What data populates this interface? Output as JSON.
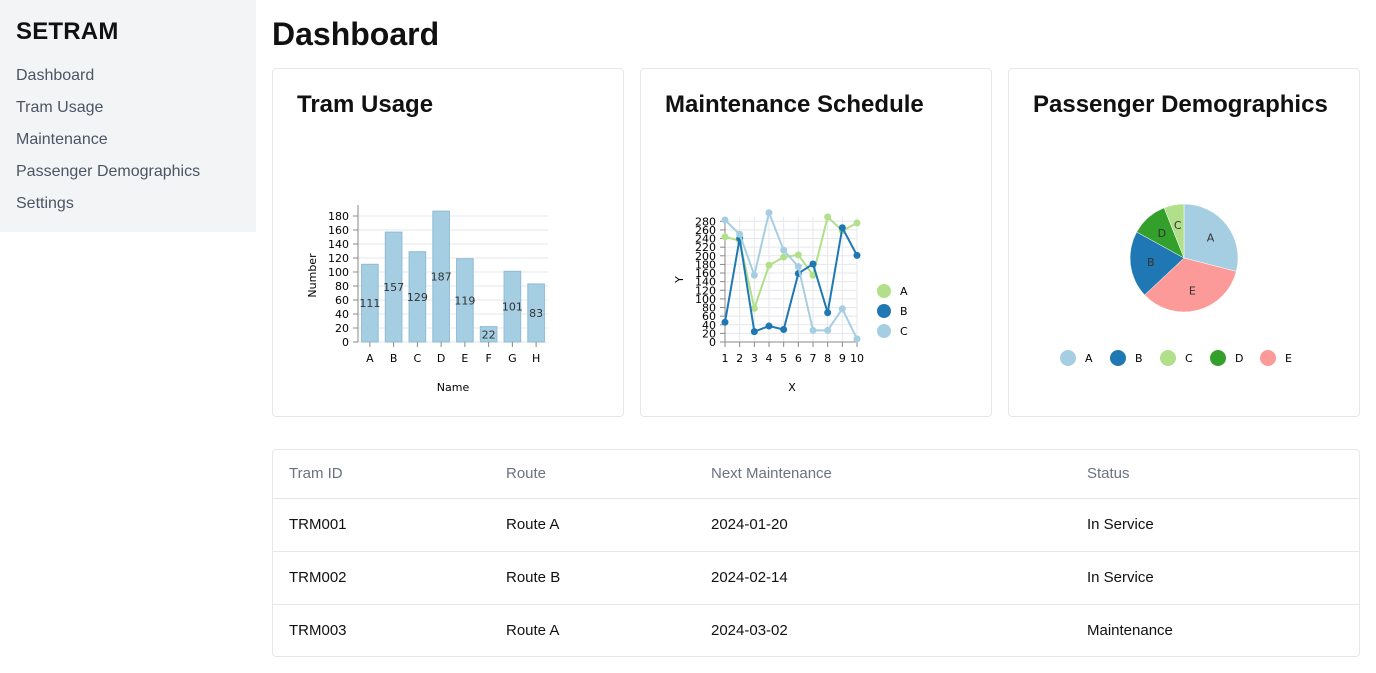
{
  "brand": "SETRAM",
  "nav": [
    {
      "label": "Dashboard",
      "name": "nav-item-dashboard"
    },
    {
      "label": "Tram Usage",
      "name": "nav-item-tram-usage"
    },
    {
      "label": "Maintenance",
      "name": "nav-item-maintenance"
    },
    {
      "label": "Passenger Demographics",
      "name": "nav-item-passenger-demographics"
    },
    {
      "label": "Settings",
      "name": "nav-item-settings"
    }
  ],
  "page_title": "Dashboard",
  "cards": {
    "usage_title": "Tram Usage",
    "maintenance_title": "Maintenance Schedule",
    "demographics_title": "Passenger Demographics"
  },
  "chart_data": [
    {
      "type": "bar",
      "title": "Tram Usage",
      "xlabel": "Name",
      "ylabel": "Number",
      "categories": [
        "A",
        "B",
        "C",
        "D",
        "E",
        "F",
        "G",
        "H"
      ],
      "values": [
        111,
        157,
        129,
        187,
        119,
        22,
        101,
        83
      ],
      "yticks": [
        0,
        20,
        40,
        60,
        80,
        100,
        120,
        140,
        160,
        180
      ],
      "ylim": [
        0,
        190
      ],
      "grid": true,
      "color": "#a6cee3"
    },
    {
      "type": "line",
      "title": "Maintenance Schedule",
      "xlabel": "X",
      "ylabel": "Y",
      "x": [
        1,
        2,
        3,
        4,
        5,
        6,
        7,
        8,
        9,
        10
      ],
      "xlim": [
        1,
        10
      ],
      "ylim": [
        0,
        290
      ],
      "yticks": [
        0,
        20,
        40,
        60,
        80,
        100,
        120,
        140,
        160,
        180,
        200,
        220,
        240,
        260,
        280
      ],
      "grid": true,
      "legend": "right",
      "series": [
        {
          "name": "A",
          "color": "#b2df8a",
          "values": [
            244,
            235,
            78,
            178,
            197,
            202,
            155,
            290,
            258,
            276
          ]
        },
        {
          "name": "B",
          "color": "#1f78b4",
          "values": [
            46,
            240,
            24,
            37,
            29,
            159,
            181,
            68,
            265,
            201
          ]
        },
        {
          "name": "C",
          "color": "#a6cee3",
          "values": [
            283,
            250,
            155,
            300,
            213,
            175,
            27,
            27,
            77,
            7
          ]
        }
      ]
    },
    {
      "type": "pie",
      "title": "Passenger Demographics",
      "legend": "bottom",
      "slices": [
        {
          "label": "A",
          "value": 29,
          "color": "#a6cee3"
        },
        {
          "label": "B",
          "value": 20,
          "color": "#1f78b4"
        },
        {
          "label": "C",
          "value": 6,
          "color": "#b2df8a"
        },
        {
          "label": "D",
          "value": 11,
          "color": "#33a02c"
        },
        {
          "label": "E",
          "value": 34,
          "color": "#fb9a99"
        }
      ],
      "slice_order": [
        "A",
        "E",
        "B",
        "D",
        "C"
      ]
    }
  ],
  "table": {
    "headers": [
      "Tram ID",
      "Route",
      "Next Maintenance",
      "Status"
    ],
    "rows": [
      [
        "TRM001",
        "Route A",
        "2024-01-20",
        "In Service"
      ],
      [
        "TRM002",
        "Route B",
        "2024-02-14",
        "In Service"
      ],
      [
        "TRM003",
        "Route A",
        "2024-03-02",
        "Maintenance"
      ]
    ]
  }
}
